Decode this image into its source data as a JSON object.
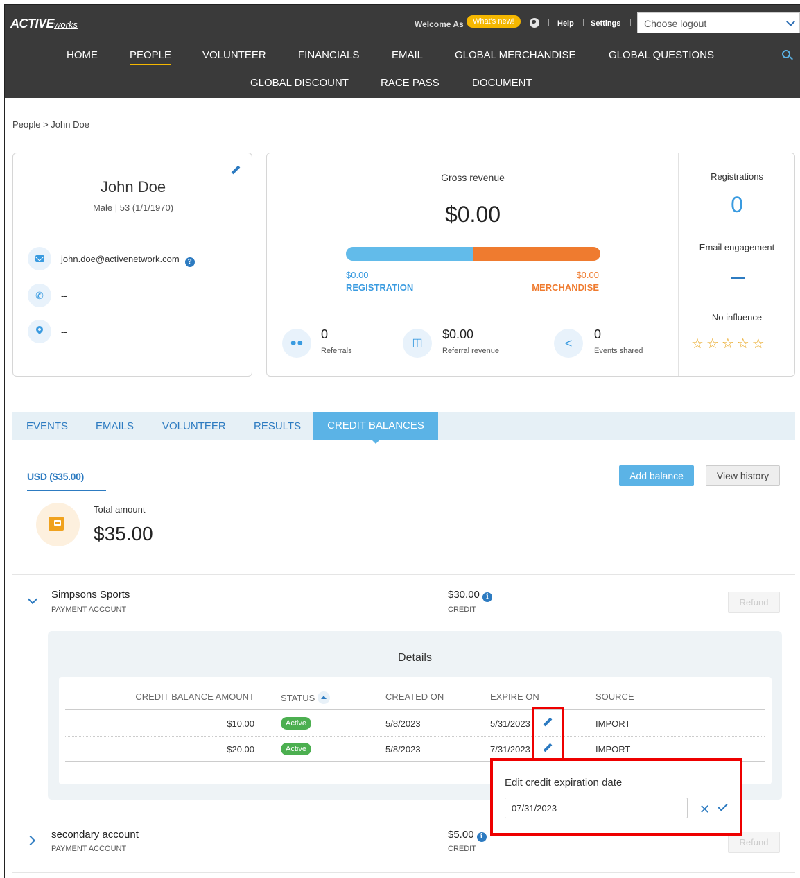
{
  "header": {
    "logo_main": "ACTIVE",
    "logo_sub": "works",
    "welcome": "Welcome As",
    "whats_new": "What's new!",
    "help": "Help",
    "settings": "Settings",
    "logout_select": "Choose logout"
  },
  "nav": {
    "items": [
      "HOME",
      "PEOPLE",
      "VOLUNTEER",
      "FINANCIALS",
      "EMAIL",
      "GLOBAL MERCHANDISE",
      "GLOBAL QUESTIONS",
      "GLOBAL DISCOUNT",
      "RACE PASS",
      "DOCUMENT"
    ],
    "active": "PEOPLE"
  },
  "breadcrumb": "People  >  John Doe",
  "profile": {
    "name": "John Doe",
    "meta": "Male  |  53 (1/1/1970)",
    "email": "john.doe@activenetwork.com",
    "phone": "--",
    "address": "--"
  },
  "revenue": {
    "title": "Gross revenue",
    "total": "$0.00",
    "registration_share": 0.5,
    "registration_value": "$0.00",
    "registration_label": "REGISTRATION",
    "merchandise_value": "$0.00",
    "merchandise_label": "MERCHANDISE",
    "referrals_value": "0",
    "referrals_label": "Referrals",
    "referral_revenue_value": "$0.00",
    "referral_revenue_label": "Referral revenue",
    "events_shared_value": "0",
    "events_shared_label": "Events shared"
  },
  "side_stats": {
    "registrations_label": "Registrations",
    "registrations_value": "0",
    "email_label": "Email engagement",
    "influence_label": "No influence",
    "stars": "☆☆☆☆☆",
    "rating": 0
  },
  "tabs": [
    "EVENTS",
    "EMAILS",
    "VOLUNTEER",
    "RESULTS",
    "CREDIT BALANCES"
  ],
  "credit": {
    "currency_tab": "USD ($35.00)",
    "add_balance": "Add balance",
    "view_history": "View history",
    "total_label": "Total amount",
    "total_value": "$35.00"
  },
  "accounts": [
    {
      "name": "Simpsons Sports",
      "type": "PAYMENT ACCOUNT",
      "amount": "$30.00",
      "amount_label": "CREDIT",
      "refund": "Refund"
    },
    {
      "name": "secondary account",
      "type": "PAYMENT ACCOUNT",
      "amount": "$5.00",
      "amount_label": "CREDIT",
      "refund": "Refund"
    }
  ],
  "details": {
    "title": "Details",
    "columns": [
      "CREDIT BALANCE AMOUNT",
      "STATUS",
      "CREATED ON",
      "EXPIRE ON",
      "SOURCE"
    ],
    "rows": [
      {
        "amount": "$10.00",
        "status": "Active",
        "created": "5/8/2023",
        "expire": "5/31/2023",
        "source": "IMPORT"
      },
      {
        "amount": "$20.00",
        "status": "Active",
        "created": "5/8/2023",
        "expire": "7/31/2023",
        "source": "IMPORT"
      }
    ]
  },
  "edit_popover": {
    "title": "Edit credit expiration date",
    "value": "07/31/2023"
  },
  "colors": {
    "accent": "#5bb3e6",
    "registration": "#62bbea",
    "merchandise": "#ef7b2f",
    "highlight": "#ee0000"
  }
}
